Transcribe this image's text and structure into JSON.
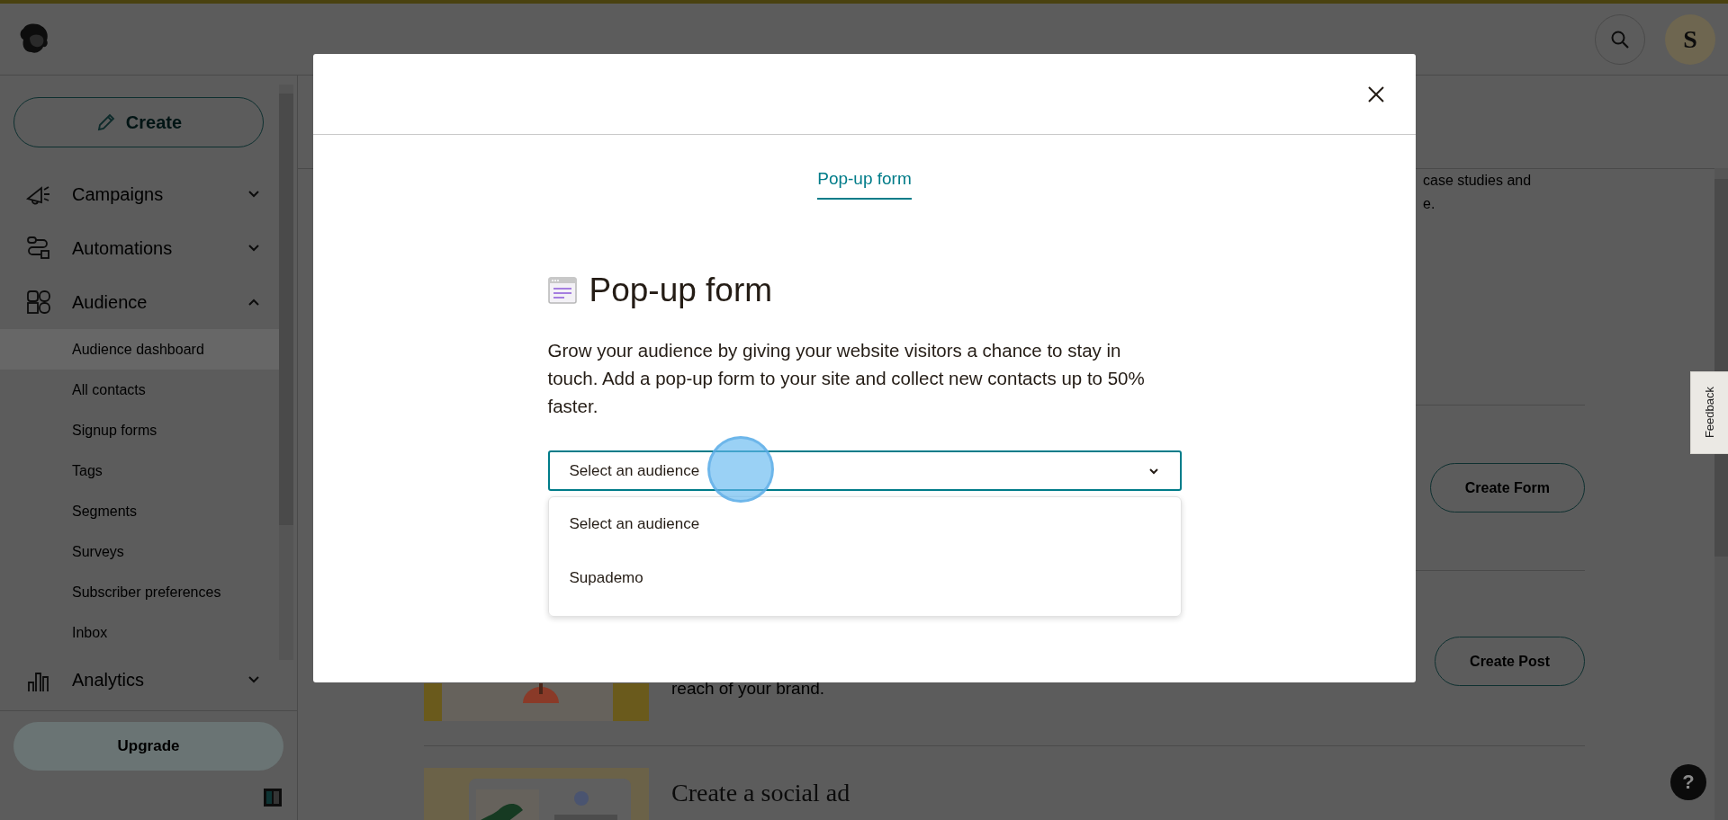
{
  "top_bar": {
    "avatar_initial": "S"
  },
  "sidebar": {
    "create_button": "Create",
    "nav": [
      {
        "label": "Campaigns",
        "expanded": false
      },
      {
        "label": "Automations",
        "expanded": false
      },
      {
        "label": "Audience",
        "expanded": true,
        "children": [
          {
            "label": "Audience dashboard",
            "selected": true
          },
          {
            "label": "All contacts",
            "selected": false
          },
          {
            "label": "Signup forms",
            "selected": false
          },
          {
            "label": "Tags",
            "selected": false
          },
          {
            "label": "Segments",
            "selected": false
          },
          {
            "label": "Surveys",
            "selected": false
          },
          {
            "label": "Subscriber preferences",
            "selected": false
          },
          {
            "label": "Inbox",
            "selected": false
          }
        ]
      },
      {
        "label": "Analytics",
        "expanded": false
      }
    ],
    "upgrade_button": "Upgrade"
  },
  "main": {
    "intro_lines": [
      "case studies and",
      "e."
    ],
    "cards": [
      {
        "button": "Create Form"
      },
      {
        "description": "reach of your brand.",
        "button": "Create Post",
        "kind": "picture"
      },
      {
        "title": "Create a social ad",
        "kind": "picture"
      }
    ]
  },
  "feedback_tab": "Feedback",
  "help_button": "?",
  "modal": {
    "tabs": [
      {
        "label": "Pop-up form",
        "selected": true
      }
    ],
    "title": "Pop-up form",
    "description": "Grow your audience by giving your website visitors a chance to stay in touch. Add a pop-up form to your site and collect new contacts up to 50% faster.",
    "select": {
      "value": "Select an audience",
      "open": true,
      "options": [
        {
          "label": "Select an audience"
        },
        {
          "label": "Supademo"
        }
      ]
    }
  }
}
